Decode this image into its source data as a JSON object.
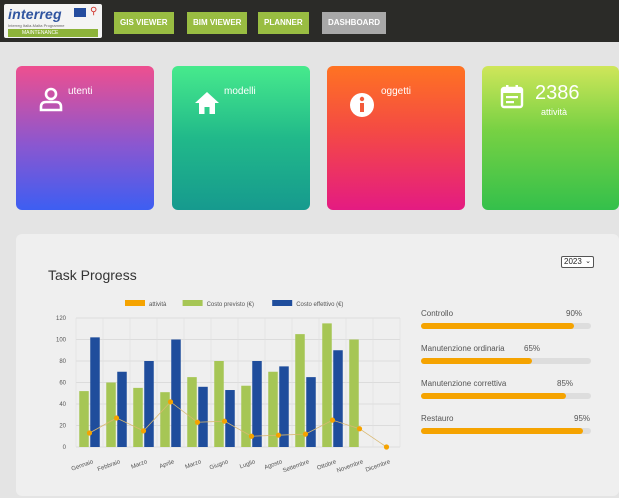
{
  "header": {
    "logo_text": "interreg",
    "logo_subtitle": "Interreg Italia-Malta Programme",
    "logo_strip": "MAINTENANCE",
    "nav": [
      {
        "label": "GIS VIEWER",
        "active": false
      },
      {
        "label": "BIM VIEWER",
        "active": false
      },
      {
        "label": "PLANNER",
        "active": false
      },
      {
        "label": "DASHBOARD",
        "active": true
      }
    ]
  },
  "cards": [
    {
      "icon": "user-icon",
      "label": "utenti"
    },
    {
      "icon": "home-icon",
      "label": "modelli"
    },
    {
      "icon": "info-icon",
      "label": "oggetti"
    },
    {
      "icon": "calendar-icon",
      "value": "2386",
      "label": "attività"
    }
  ],
  "panel": {
    "title": "Task Progress",
    "year": "2023"
  },
  "chart_data": {
    "type": "bar",
    "categories": [
      "Gennaio",
      "Febbraio",
      "Marzo",
      "Aprile",
      "Marzo",
      "Giugno",
      "Luglio",
      "Agosto",
      "Settembre",
      "Ottobre",
      "Novembre",
      "Dicembre"
    ],
    "series": [
      {
        "name": "attività",
        "kind": "line",
        "color": "#f5a300",
        "values": [
          13,
          27,
          15,
          42,
          23,
          24,
          10,
          11,
          12,
          25,
          17,
          0
        ]
      },
      {
        "name": "Costo previsto (€)",
        "kind": "bar",
        "color": "#a6c655",
        "values": [
          52,
          60,
          55,
          51,
          65,
          80,
          57,
          70,
          105,
          115,
          100,
          null
        ]
      },
      {
        "name": "Costo effettivo (€)",
        "kind": "bar",
        "color": "#1f4d9c",
        "values": [
          102,
          70,
          80,
          100,
          56,
          53,
          80,
          75,
          65,
          90,
          null,
          null
        ]
      }
    ],
    "ylim": [
      0,
      120
    ],
    "yticks": [
      0,
      20,
      40,
      60,
      80,
      100,
      120
    ],
    "grid": true,
    "legend": "top"
  },
  "progress": [
    {
      "label": "Controllo",
      "value": "90%",
      "pct": 90
    },
    {
      "label": "Manutenzione ordinaria",
      "value": "65%",
      "pct": 65
    },
    {
      "label": "Manutenzione correttiva",
      "value": "85%",
      "pct": 85
    },
    {
      "label": "Restauro",
      "value": "95%",
      "pct": 95
    }
  ],
  "colors": {
    "accent": "#99bd42",
    "topbar": "#2b2b28",
    "progress": "#f5a300"
  }
}
